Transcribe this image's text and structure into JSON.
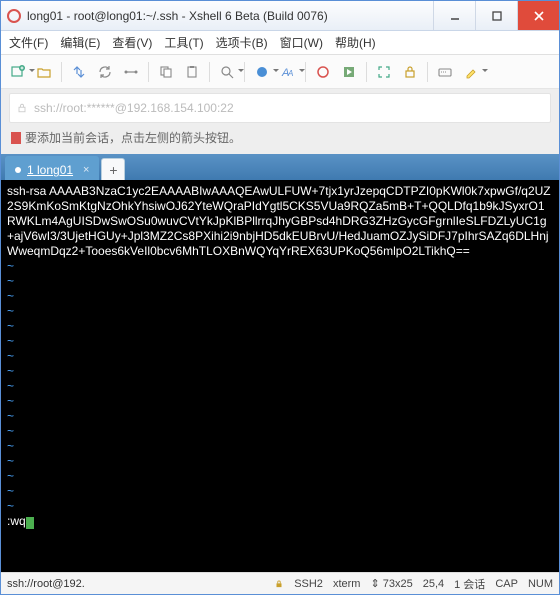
{
  "window": {
    "title": "long01 - root@long01:~/.ssh - Xshell 6 Beta (Build 0076)"
  },
  "menu": {
    "file": "文件(F)",
    "edit": "编辑(E)",
    "view": "查看(V)",
    "tool": "工具(T)",
    "tab": "选项卡(B)",
    "window": "窗口(W)",
    "help": "帮助(H)"
  },
  "address": {
    "text": "ssh://root:******@192.168.154.100:22"
  },
  "hint": {
    "text": "要添加当前会话，点击左侧的箭头按钮。"
  },
  "tabs": {
    "t0": {
      "label": "1 long01"
    },
    "add": "+"
  },
  "terminal": {
    "content": "ssh-rsa AAAAB3NzaC1yc2EAAAABIwAAAQEAwULFUW+7tjx1yrJzepqCDTPZI0pKWl0k7xpwGf/q2UZ2S9KmKoSmKtgNzOhkYhsiwOJ62YteWQraPIdYgtl5CKS5VUa9RQZa5mB+T+QQLDfq1b9kJSyxrO1RWKLm4AgUISDwSwOSu0wuvCVtYkJpKlBPllrrqJhyGBPsd4hDRG3ZHzGycGFgrnlIeSLFDZLyUC1g+ajV6wI3/3UjetHGUy+Jpl3MZ2Cs8PXihi2i9nbjHD5dkEUBrvU/HedJuamOZJySiDFJ7pIhrSAZq6DLHnjWweqmDqz2+Tooes6kVeIl0bcv6MhTLOXBnWQYqYrREX63UPKoQ56mlpO2LTikhQ==",
    "cmd": ":wq"
  },
  "status": {
    "conn": "ssh://root@192.",
    "proto": "SSH2",
    "term": "xterm",
    "size": "73x25",
    "pos": "25,4",
    "sess": "1 会话",
    "cap": "CAP",
    "num": "NUM"
  }
}
